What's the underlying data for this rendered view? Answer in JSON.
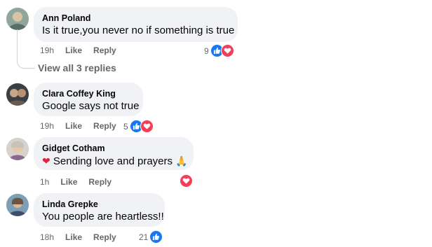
{
  "comments": [
    {
      "author": "Ann Poland",
      "text": "Is it true,you never no if something is true",
      "time": "19h",
      "like": "Like",
      "reply": "Reply",
      "reaction_count": "9",
      "reactions": [
        "like-icon",
        "love-icon"
      ]
    },
    {
      "author": "Clara Coffey King",
      "text": "Google says not true",
      "time": "19h",
      "like": "Like",
      "reply": "Reply",
      "reaction_count": "5",
      "reactions": [
        "like-icon",
        "love-icon"
      ]
    },
    {
      "author": "Gidget Cotham",
      "text_prefix_emoji": "heart-emoji",
      "text": "Sending love and prayers",
      "text_suffix_emoji": "praying-hands-emoji",
      "time": "1h",
      "like": "Like",
      "reply": "Reply",
      "reaction_count": "",
      "reactions": [
        "love-icon"
      ]
    },
    {
      "author": "Linda Grepke",
      "text": "You people are heartless!!",
      "time": "18h",
      "like": "Like",
      "reply": "Reply",
      "reaction_count": "21",
      "reactions": [
        "like-icon"
      ]
    }
  ],
  "view_replies": "View all 3 replies",
  "colors": {
    "bubble": "#f0f2f5",
    "like": "#1877f2",
    "love": "#f33e58",
    "meta": "#65676b"
  }
}
